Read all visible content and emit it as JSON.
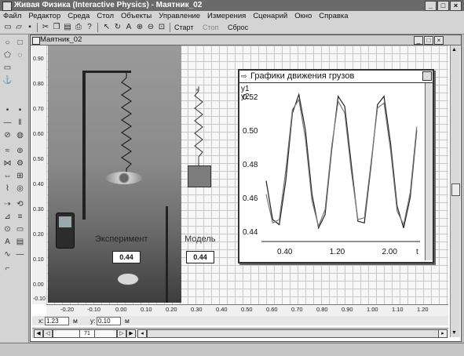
{
  "app": {
    "window_title": "Живая Физика (Interactive Physics) - Маятник_02"
  },
  "menu": [
    "Файл",
    "Редактор",
    "Среда",
    "Стол",
    "Объекты",
    "Управление",
    "Измерения",
    "Сценарий",
    "Окно",
    "Справка"
  ],
  "toolbar": {
    "start_label": "Старт",
    "stop_label": "Стоп",
    "reset_label": "Сброс"
  },
  "document": {
    "title": "Маятник_02",
    "ruler_y": [
      "0.90",
      "0.80",
      "0.70",
      "0.60",
      "0.50",
      "0.40",
      "0.30",
      "0.20",
      "0.10",
      "0.00",
      "-0.10"
    ],
    "ruler_x": [
      "-0.20",
      "-0.10",
      "0.00",
      "0.10",
      "0.20",
      "0.30",
      "0.40",
      "0.50",
      "0.60",
      "0.70",
      "0.80",
      "0.90",
      "1.00",
      "1.10",
      "1.20"
    ],
    "experiment_label": "Эксперимент",
    "model_label": "Модель",
    "experiment_value": "0.44",
    "model_value": "0.44"
  },
  "graph": {
    "title": "Графики движения грузов",
    "legend": [
      "y1",
      "y2"
    ],
    "y_ticks": [
      "0.52",
      "0.50",
      "0.48",
      "0.46",
      "0.44"
    ],
    "x_ticks": [
      "0.40",
      "1.20",
      "2.00"
    ],
    "x_label": "t"
  },
  "chart_data": {
    "type": "line",
    "title": "Графики движения грузов",
    "xlabel": "t",
    "ylabel": "",
    "xlim": [
      0.1,
      2.45
    ],
    "ylim": [
      0.434,
      0.525
    ],
    "series": [
      {
        "name": "y1",
        "x": [
          0.1,
          0.2,
          0.3,
          0.4,
          0.5,
          0.6,
          0.7,
          0.8,
          0.9,
          1.0,
          1.1,
          1.2,
          1.3,
          1.4,
          1.5,
          1.6,
          1.7,
          1.8,
          1.9,
          2.0,
          2.1,
          2.2,
          2.3,
          2.4
        ],
        "values": [
          0.47,
          0.447,
          0.444,
          0.47,
          0.51,
          0.521,
          0.5,
          0.462,
          0.442,
          0.45,
          0.488,
          0.52,
          0.514,
          0.48,
          0.446,
          0.445,
          0.478,
          0.515,
          0.52,
          0.492,
          0.455,
          0.442,
          0.46,
          0.5
        ]
      },
      {
        "name": "y2",
        "x": [
          0.1,
          0.2,
          0.3,
          0.4,
          0.5,
          0.6,
          0.7,
          0.8,
          0.9,
          1.0,
          1.1,
          1.2,
          1.3,
          1.4,
          1.5,
          1.6,
          1.7,
          1.8,
          1.9,
          2.0,
          2.1,
          2.2,
          2.3,
          2.4
        ],
        "values": [
          0.462,
          0.445,
          0.447,
          0.476,
          0.512,
          0.518,
          0.495,
          0.458,
          0.443,
          0.453,
          0.49,
          0.517,
          0.51,
          0.476,
          0.447,
          0.448,
          0.48,
          0.513,
          0.516,
          0.488,
          0.452,
          0.444,
          0.463,
          0.502
        ]
      }
    ]
  },
  "coords": {
    "x_label": "x:",
    "x_value": "1.23",
    "x_unit": "м",
    "y_label": "y:",
    "y_value": "0.10",
    "y_unit": "м"
  },
  "hscroll": {
    "frame_value": "71"
  }
}
